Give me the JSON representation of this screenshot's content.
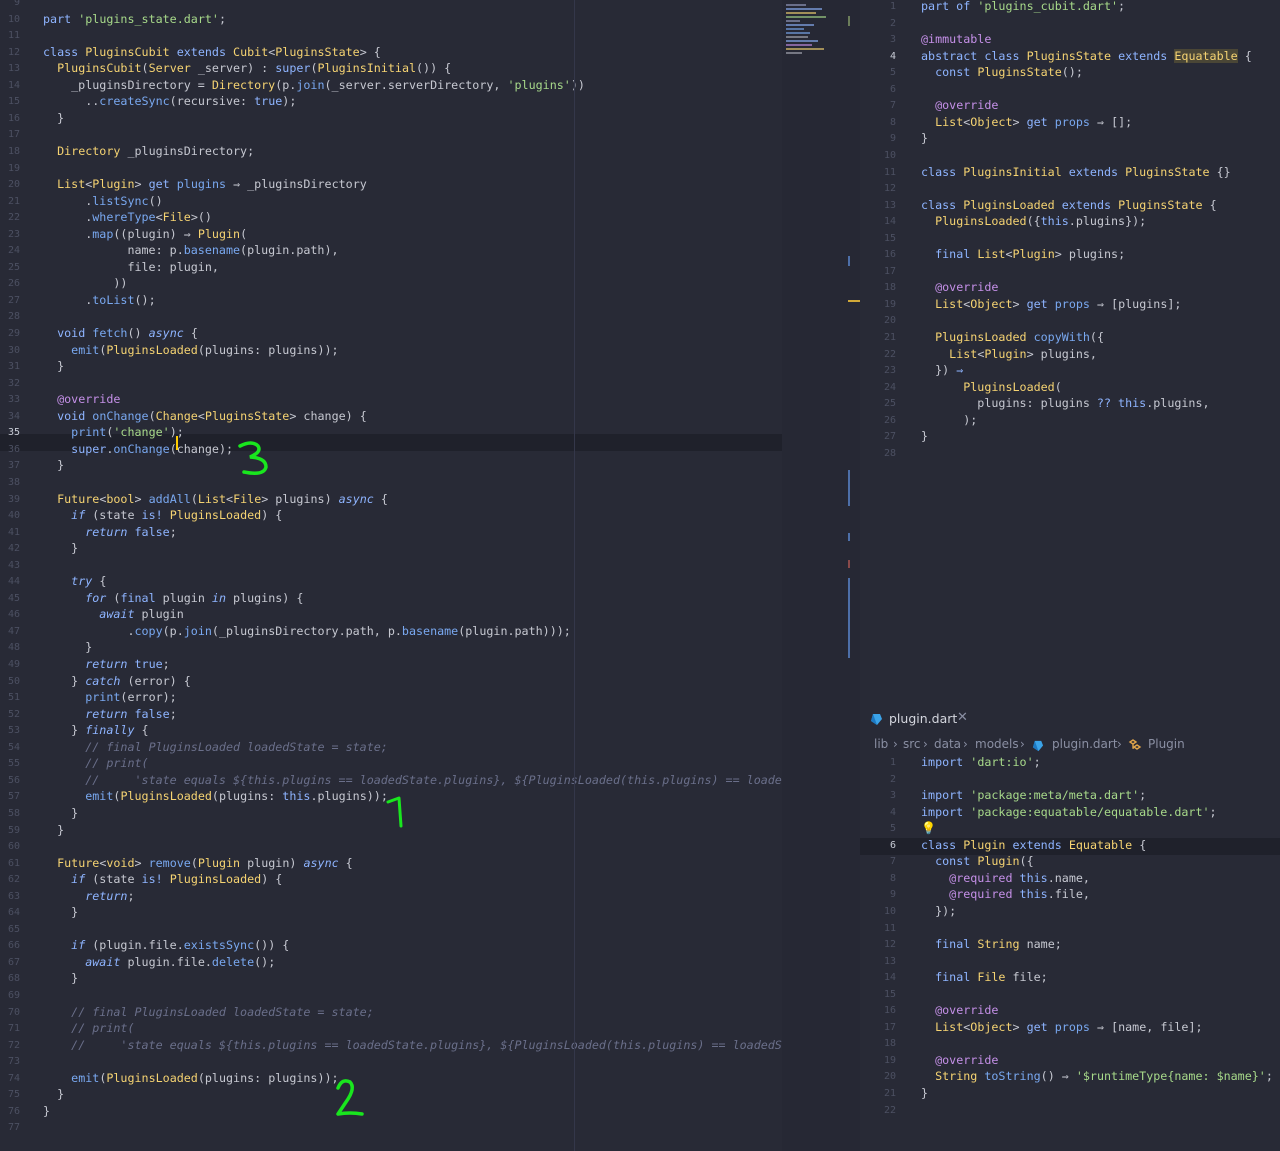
{
  "left_editor": {
    "lines": [
      {
        "n": "9",
        "html": ""
      },
      {
        "n": "10",
        "html": "<span class=\"kw\">part</span> <span class=\"st\">'plugins_state.dart'</span>;"
      },
      {
        "n": "11",
        "html": ""
      },
      {
        "n": "12",
        "html": "<span class=\"kw\">class</span> <span class=\"ty\">PluginsCubit</span> <span class=\"kw\">extends</span> <span class=\"ty\">Cubit</span>&lt;<span class=\"ty\">PluginsState</span>&gt; {"
      },
      {
        "n": "13",
        "html": "  <span class=\"ty\">PluginsCubit</span>(<span class=\"ty\">Server</span> _server) : <span class=\"kw\">super</span>(<span class=\"ty\">PluginsInitial</span>()) {"
      },
      {
        "n": "14",
        "html": "    _pluginsDirectory = <span class=\"ty\">Directory</span>(p.<span class=\"fn\">join</span>(_server.serverDirectory, <span class=\"st\">'plugins'</span>))"
      },
      {
        "n": "15",
        "html": "      ..<span class=\"fn\">createSync</span>(recursive: <span class=\"kw\">true</span>);"
      },
      {
        "n": "16",
        "html": "  }"
      },
      {
        "n": "17",
        "html": ""
      },
      {
        "n": "18",
        "html": "  <span class=\"ty\">Directory</span> _pluginsDirectory;"
      },
      {
        "n": "19",
        "html": ""
      },
      {
        "n": "20",
        "html": "  <span class=\"ty\">List</span>&lt;<span class=\"ty\">Plugin</span>&gt; <span class=\"kw\">get</span> <span class=\"fn\">plugins</span> ⇒ _pluginsDirectory"
      },
      {
        "n": "21",
        "html": "      .<span class=\"fn\">listSync</span>()"
      },
      {
        "n": "22",
        "html": "      .<span class=\"fn\">whereType</span>&lt;<span class=\"ty\">File</span>&gt;()"
      },
      {
        "n": "23",
        "html": "      .<span class=\"fn\">map</span>((plugin) ⇒ <span class=\"ty\">Plugin</span>("
      },
      {
        "n": "24",
        "html": "            name: p.<span class=\"fn\">basename</span>(plugin.path),"
      },
      {
        "n": "25",
        "html": "            file: plugin,"
      },
      {
        "n": "26",
        "html": "          ))"
      },
      {
        "n": "27",
        "html": "      .<span class=\"fn\">toList</span>();"
      },
      {
        "n": "28",
        "html": ""
      },
      {
        "n": "29",
        "html": "  <span class=\"kw\">void</span> <span class=\"fn\">fetch</span>() <span class=\"kwi\">async</span> {"
      },
      {
        "n": "30",
        "html": "    <span class=\"fn\">emit</span>(<span class=\"ty\">PluginsLoaded</span>(plugins: plugins));"
      },
      {
        "n": "31",
        "html": "  }"
      },
      {
        "n": "32",
        "html": ""
      },
      {
        "n": "33",
        "html": "  <span class=\"an\">@override</span>"
      },
      {
        "n": "34",
        "html": "  <span class=\"kw\">void</span> <span class=\"fn\">onChange</span>(<span class=\"ty\">Change</span>&lt;<span class=\"ty\">PluginsState</span>&gt; change) {"
      },
      {
        "n": "35",
        "html": "    <span class=\"fn\">print</span>(<span class=\"st\">'change'</span>);"
      },
      {
        "n": "36",
        "html": "    <span class=\"kw\">super</span>.<span class=\"fn\">onChange</span>(change);"
      },
      {
        "n": "37",
        "html": "  }"
      },
      {
        "n": "38",
        "html": ""
      },
      {
        "n": "39",
        "html": "  <span class=\"ty\">Future</span>&lt;<span class=\"ty\">bool</span>&gt; <span class=\"fn\">addAll</span>(<span class=\"ty\">List</span>&lt;<span class=\"ty\">File</span>&gt; plugins) <span class=\"kwi\">async</span> {"
      },
      {
        "n": "40",
        "html": "    <span class=\"kwi\">if</span> (state <span class=\"kw\">is!</span> <span class=\"ty\">PluginsLoaded</span>) {"
      },
      {
        "n": "41",
        "html": "      <span class=\"kwi\">return</span> <span class=\"kw\">false</span>;"
      },
      {
        "n": "42",
        "html": "    }"
      },
      {
        "n": "43",
        "html": ""
      },
      {
        "n": "44",
        "html": "    <span class=\"kwi\">try</span> {"
      },
      {
        "n": "45",
        "html": "      <span class=\"kwi\">for</span> (<span class=\"kw\">final</span> plugin <span class=\"kwi\">in</span> plugins) {"
      },
      {
        "n": "46",
        "html": "        <span class=\"kwi\">await</span> plugin"
      },
      {
        "n": "47",
        "html": "            .<span class=\"fn\">copy</span>(p.<span class=\"fn\">join</span>(_pluginsDirectory.path, p.<span class=\"fn\">basename</span>(plugin.path)));"
      },
      {
        "n": "48",
        "html": "      }"
      },
      {
        "n": "49",
        "html": "      <span class=\"kwi\">return</span> <span class=\"kw\">true</span>;"
      },
      {
        "n": "50",
        "html": "    } <span class=\"kwi\">catch</span> (error) {"
      },
      {
        "n": "51",
        "html": "      <span class=\"fn\">print</span>(error);"
      },
      {
        "n": "52",
        "html": "      <span class=\"kwi\">return</span> <span class=\"kw\">false</span>;"
      },
      {
        "n": "53",
        "html": "    } <span class=\"kwi\">finally</span> {"
      },
      {
        "n": "54",
        "html": "      <span class=\"cm\">// final PluginsLoaded loadedState = state;</span>"
      },
      {
        "n": "55",
        "html": "      <span class=\"cm\">// print(</span>"
      },
      {
        "n": "56",
        "html": "      <span class=\"cm\">//     'state equals ${this.plugins == loadedState.plugins}, ${PluginsLoaded(this.plugins) == loadedState</span>"
      },
      {
        "n": "57",
        "html": "      <span class=\"fn\">emit</span>(<span class=\"ty\">PluginsLoaded</span>(plugins: <span class=\"kw\">this</span>.plugins));"
      },
      {
        "n": "58",
        "html": "    }"
      },
      {
        "n": "59",
        "html": "  }"
      },
      {
        "n": "60",
        "html": ""
      },
      {
        "n": "61",
        "html": "  <span class=\"ty\">Future</span>&lt;<span class=\"ty\">void</span>&gt; <span class=\"fn\">remove</span>(<span class=\"ty\">Plugin</span> plugin) <span class=\"kwi\">async</span> {"
      },
      {
        "n": "62",
        "html": "    <span class=\"kwi\">if</span> (state <span class=\"kw\">is!</span> <span class=\"ty\">PluginsLoaded</span>) {"
      },
      {
        "n": "63",
        "html": "      <span class=\"kwi\">return</span>;"
      },
      {
        "n": "64",
        "html": "    }"
      },
      {
        "n": "65",
        "html": ""
      },
      {
        "n": "66",
        "html": "    <span class=\"kwi\">if</span> (plugin.file.<span class=\"fn\">existsSync</span>()) {"
      },
      {
        "n": "67",
        "html": "      <span class=\"kwi\">await</span> plugin.file.<span class=\"fn\">delete</span>();"
      },
      {
        "n": "68",
        "html": "    }"
      },
      {
        "n": "69",
        "html": ""
      },
      {
        "n": "70",
        "html": "    <span class=\"cm\">// final PluginsLoaded loadedState = state;</span>"
      },
      {
        "n": "71",
        "html": "    <span class=\"cm\">// print(</span>"
      },
      {
        "n": "72",
        "html": "    <span class=\"cm\">//     'state equals ${this.plugins == loadedState.plugins}, ${PluginsLoaded(this.plugins) == loadedState}'</span>"
      },
      {
        "n": "73",
        "html": ""
      },
      {
        "n": "74",
        "html": "    <span class=\"fn\">emit</span>(<span class=\"ty\">PluginsLoaded</span>(plugins: plugins));"
      },
      {
        "n": "75",
        "html": "  }"
      },
      {
        "n": "76",
        "html": "}"
      },
      {
        "n": "77",
        "html": ""
      }
    ],
    "active_line": "35",
    "annotations": [
      "3",
      "1",
      "2"
    ]
  },
  "right_top_editor": {
    "lines": [
      {
        "n": "1",
        "html": "<span class=\"kw\">part of</span> <span class=\"st\">'plugins_cubit.dart'</span>;"
      },
      {
        "n": "2",
        "html": ""
      },
      {
        "n": "3",
        "html": "<span class=\"an\">@immutable</span>"
      },
      {
        "n": "4",
        "html": "<span class=\"kw\">abstract class</span> <span class=\"ty\">PluginsState</span> <span class=\"kw\">extends</span> <span class=\"ty\" style=\"background:#4a4636\">Equatable</span> {"
      },
      {
        "n": "5",
        "html": "  <span class=\"kw\">const</span> <span class=\"ty\">PluginsState</span>();"
      },
      {
        "n": "6",
        "html": ""
      },
      {
        "n": "7",
        "html": "  <span class=\"an\">@override</span>"
      },
      {
        "n": "8",
        "html": "  <span class=\"ty\">List</span>&lt;<span class=\"ty\">Object</span>&gt; <span class=\"kw\">get</span> <span class=\"fn\">props</span> ⇒ [];"
      },
      {
        "n": "9",
        "html": "}"
      },
      {
        "n": "10",
        "html": ""
      },
      {
        "n": "11",
        "html": "<span class=\"kw\">class</span> <span class=\"ty\">PluginsInitial</span> <span class=\"kw\">extends</span> <span class=\"ty\">PluginsState</span> {}"
      },
      {
        "n": "12",
        "html": ""
      },
      {
        "n": "13",
        "html": "<span class=\"kw\">class</span> <span class=\"ty\">PluginsLoaded</span> <span class=\"kw\">extends</span> <span class=\"ty\">PluginsState</span> {"
      },
      {
        "n": "14",
        "html": "  <span class=\"ty\">PluginsLoaded</span>({<span class=\"kw\">this</span>.plugins});"
      },
      {
        "n": "15",
        "html": ""
      },
      {
        "n": "16",
        "html": "  <span class=\"kw\">final</span> <span class=\"ty\">List</span>&lt;<span class=\"ty\">Plugin</span>&gt; plugins;"
      },
      {
        "n": "17",
        "html": ""
      },
      {
        "n": "18",
        "html": "  <span class=\"an\">@override</span>"
      },
      {
        "n": "19",
        "html": "  <span class=\"ty\">List</span>&lt;<span class=\"ty\">Object</span>&gt; <span class=\"kw\">get</span> <span class=\"fn\">props</span> ⇒ [plugins];"
      },
      {
        "n": "20",
        "html": ""
      },
      {
        "n": "21",
        "html": "  <span class=\"ty\">PluginsLoaded</span> <span class=\"fn\">copyWith</span>({"
      },
      {
        "n": "22",
        "html": "    <span class=\"ty\">List</span>&lt;<span class=\"ty\">Plugin</span>&gt; plugins,"
      },
      {
        "n": "23",
        "html": "  }) <span class=\"kw\">⇒</span>"
      },
      {
        "n": "24",
        "html": "      <span class=\"ty\">PluginsLoaded</span>("
      },
      {
        "n": "25",
        "html": "        plugins: plugins <span class=\"kw\">??</span> <span class=\"kw\">this</span>.plugins,"
      },
      {
        "n": "26",
        "html": "      );"
      },
      {
        "n": "27",
        "html": "}"
      },
      {
        "n": "28",
        "html": ""
      }
    ],
    "active_line": "4"
  },
  "right_bottom_editor": {
    "tab_label": "plugin.dart",
    "breadcrumb": [
      "lib",
      "src",
      "data",
      "models",
      "plugin.dart",
      "Plugin"
    ],
    "lines": [
      {
        "n": "1",
        "html": "<span class=\"kw\">import</span> <span class=\"st\">'dart:io'</span>;"
      },
      {
        "n": "2",
        "html": ""
      },
      {
        "n": "3",
        "html": "<span class=\"kw\">import</span> <span class=\"st\">'package:meta/meta.dart'</span>;"
      },
      {
        "n": "4",
        "html": "<span class=\"kw\">import</span> <span class=\"st\">'package:equatable/equatable.dart'</span>;"
      },
      {
        "n": "5",
        "html": ""
      },
      {
        "n": "6",
        "html": "<span class=\"kw\">class</span> <span class=\"ty\">Plugin</span> <span class=\"kw\">extends</span> <span class=\"ty\">Equatable</span> {"
      },
      {
        "n": "7",
        "html": "  <span class=\"kw\">const</span> <span class=\"ty\">Plugin</span>({"
      },
      {
        "n": "8",
        "html": "    <span class=\"an\">@required</span> <span class=\"kw\">this</span>.name,"
      },
      {
        "n": "9",
        "html": "    <span class=\"an\">@required</span> <span class=\"kw\">this</span>.file,"
      },
      {
        "n": "10",
        "html": "  });"
      },
      {
        "n": "11",
        "html": ""
      },
      {
        "n": "12",
        "html": "  <span class=\"kw\">final</span> <span class=\"ty\">String</span> name;"
      },
      {
        "n": "13",
        "html": ""
      },
      {
        "n": "14",
        "html": "  <span class=\"kw\">final</span> <span class=\"ty\">File</span> file;"
      },
      {
        "n": "15",
        "html": ""
      },
      {
        "n": "16",
        "html": "  <span class=\"an\">@override</span>"
      },
      {
        "n": "17",
        "html": "  <span class=\"ty\">List</span>&lt;<span class=\"ty\">Object</span>&gt; <span class=\"kw\">get</span> <span class=\"fn\">props</span> ⇒ [name, file];"
      },
      {
        "n": "18",
        "html": ""
      },
      {
        "n": "19",
        "html": "  <span class=\"an\">@override</span>"
      },
      {
        "n": "20",
        "html": "  <span class=\"ty\">String</span> <span class=\"fn\">toString</span>() ⇒ <span class=\"st\">'$runtimeType{name: $name}'</span>;"
      },
      {
        "n": "21",
        "html": "}"
      },
      {
        "n": "22",
        "html": ""
      }
    ],
    "active_line": "6"
  },
  "colors": {
    "background": "#282a36",
    "annotation": "#19e61e",
    "cursor": "#ffcc00"
  }
}
